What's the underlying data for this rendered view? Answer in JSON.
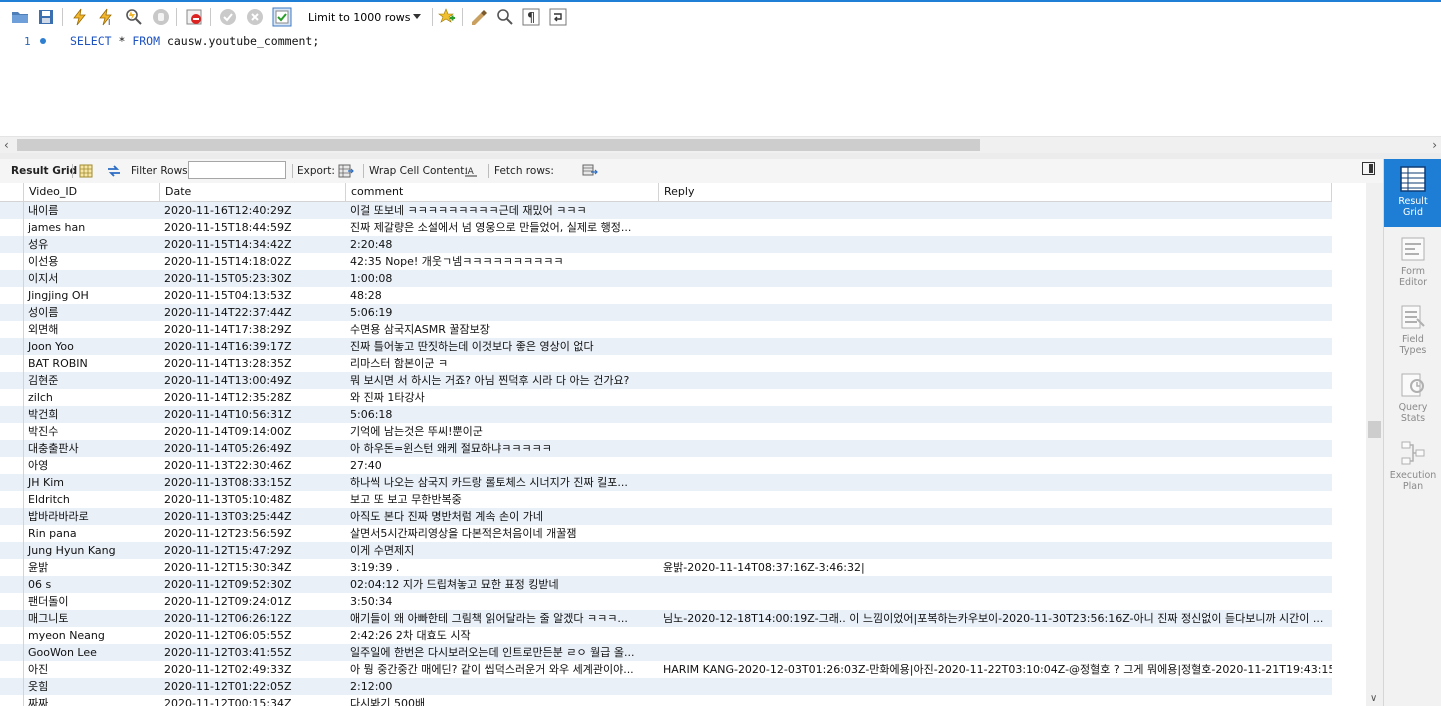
{
  "toolbar": {
    "limit_select": "Limit to 1000 rows",
    "icons": [
      "open-folder-icon",
      "save-icon",
      "execute-icon",
      "execute-current-icon",
      "explain-icon",
      "stop-icon",
      "toggle-continue-icon",
      "commit-icon",
      "rollback-icon",
      "autocommit-icon",
      "add-snippet-icon",
      "beautify-icon",
      "find-icon",
      "invisible-chars-icon",
      "wrap-icon"
    ]
  },
  "editor": {
    "line_number": "1",
    "sql_keyword_select": "SELECT",
    "sql_star": " * ",
    "sql_keyword_from": "FROM",
    "sql_rest": " causw.youtube_comment;"
  },
  "result_toolbar": {
    "result_grid": "Result Grid",
    "filter_rows": "Filter Rows:",
    "filter_value": "",
    "export": "Export:",
    "wrap_cell": "Wrap Cell Content:",
    "fetch_rows": "Fetch rows:"
  },
  "grid": {
    "columns": [
      "Video_ID",
      "Date",
      "comment",
      "Reply"
    ],
    "rows": [
      [
        "내이름",
        "2020-11-16T12:40:29Z",
        "이걸 또보네 ㅋㅋㅋㅋㅋㅋㅋㅋㅋ근데 재밌어 ㅋㅋㅋ",
        ""
      ],
      [
        "james han",
        "2020-11-15T18:44:59Z",
        "진짜 제갈량은 소설에서 넘 영웅으로 만들었어, 실제로 행정...",
        ""
      ],
      [
        "성유",
        "2020-11-15T14:34:42Z",
        "2:20:48",
        ""
      ],
      [
        "이선용",
        "2020-11-15T14:18:02Z",
        "42:35 Nope! 개웃ㄱ넴ㅋㅋㅋㅋㅋㅋㅋㅋㅋㅋ",
        ""
      ],
      [
        "이지서",
        "2020-11-15T05:23:30Z",
        "1:00:08",
        ""
      ],
      [
        "Jingjing OH",
        "2020-11-15T04:13:53Z",
        "48:28",
        ""
      ],
      [
        "성이름",
        "2020-11-14T22:37:44Z",
        "5:06:19",
        ""
      ],
      [
        "외면해",
        "2020-11-14T17:38:29Z",
        "수면용 삼국지ASMR 꿀잠보장",
        ""
      ],
      [
        "Joon Yoo",
        "2020-11-14T16:39:17Z",
        "진짜 틀어놓고 딴짓하는데 이것보다 좋은 영상이 없다",
        ""
      ],
      [
        "BAT ROBIN",
        "2020-11-14T13:28:35Z",
        "리마스터 함본이군 ㅋ",
        ""
      ],
      [
        "김현준",
        "2020-11-14T13:00:49Z",
        "뭐 보시면 서 하시는 거죠? 아님 찐덕후 시라 다 아는 건가요?",
        ""
      ],
      [
        "zilch",
        "2020-11-14T12:35:28Z",
        "와 진짜 1타강사",
        ""
      ],
      [
        "박건희",
        "2020-11-14T10:56:31Z",
        "5:06:18",
        ""
      ],
      [
        "박진수",
        "2020-11-14T09:14:00Z",
        "기억에 남는것은 뚜씨!뿐이군",
        ""
      ],
      [
        "대충출판사",
        "2020-11-14T05:26:49Z",
        "아 하우돈=윈스턴 왜케 절묘하냐ㅋㅋㅋㅋㅋ",
        ""
      ],
      [
        "아영",
        "2020-11-13T22:30:46Z",
        "27:40",
        ""
      ],
      [
        "JH Kim",
        "2020-11-13T08:33:15Z",
        "하나씩 나오는 삼국지 카드랑 롤토체스 시너지가 진짜 킬포...",
        ""
      ],
      [
        "Eldritch",
        "2020-11-13T05:10:48Z",
        "보고 또 보고 무한반복중",
        ""
      ],
      [
        "밥바라바라로",
        "2020-11-13T03:25:44Z",
        "아직도 본다 진짜 명반처럼 계속 손이 가네",
        ""
      ],
      [
        "Rin pana",
        "2020-11-12T23:56:59Z",
        "살면서5시간짜리영상을 다본적은처음이네 개꿀잼",
        ""
      ],
      [
        "Jung Hyun Kang",
        "2020-11-12T15:47:29Z",
        "이게 수면제지",
        ""
      ],
      [
        "윤밝",
        "2020-11-12T15:30:34Z",
        "3:19:39 .",
        "윤밝-2020-11-14T08:37:16Z-3:46:32|"
      ],
      [
        "06 s",
        "2020-11-12T09:52:30Z",
        "02:04:12 지가 드립쳐놓고 묘한 표정 킹받네",
        ""
      ],
      [
        "팬더돌이",
        "2020-11-12T09:24:01Z",
        "3:50:34",
        ""
      ],
      [
        "매그니토",
        "2020-11-12T06:26:12Z",
        "애기들이 왜 아빠한테 그림책 읽어달라는 줄 알겠다 ㅋㅋㅋ...",
        "님노-2020-12-18T14:00:19Z-그래.. 이 느낌이었어|포복하는카우보이-2020-11-30T23:56:16Z-아니 진짜 정신없이 듣다보니까 시간이 ..."
      ],
      [
        "myeon Neang",
        "2020-11-12T06:05:55Z",
        "2:42:26 2차 대효도 시작",
        ""
      ],
      [
        "GooWon Lee",
        "2020-11-12T03:41:55Z",
        "일주일에 한번은 다시보러오는데 인트로만든분 ㄹㅇ 월급 올...",
        ""
      ],
      [
        "아진",
        "2020-11-12T02:49:33Z",
        "아 뭥 중간중간 매에딘? 같이 씹덕스러운거 와우 세계관이야...",
        "HARIM KANG-2020-12-03T01:26:03Z-만화에용|아진-2020-11-22T03:10:04Z-@정혈호 ? 그게 뭐에용|정혈호-2020-11-21T19:43:15Z-..."
      ],
      [
        "옷힘",
        "2020-11-12T01:22:05Z",
        "2:12:00",
        ""
      ],
      [
        "짜짜",
        "2020-11-12T00:15:34Z",
        "다시봐기 500배",
        ""
      ]
    ]
  },
  "sidepanel": {
    "items": [
      {
        "line1": "Result",
        "line2": "Grid"
      },
      {
        "line1": "Form",
        "line2": "Editor"
      },
      {
        "line1": "Field",
        "line2": "Types"
      },
      {
        "line1": "Query",
        "line2": "Stats"
      },
      {
        "line1": "Execution",
        "line2": "Plan"
      }
    ]
  }
}
